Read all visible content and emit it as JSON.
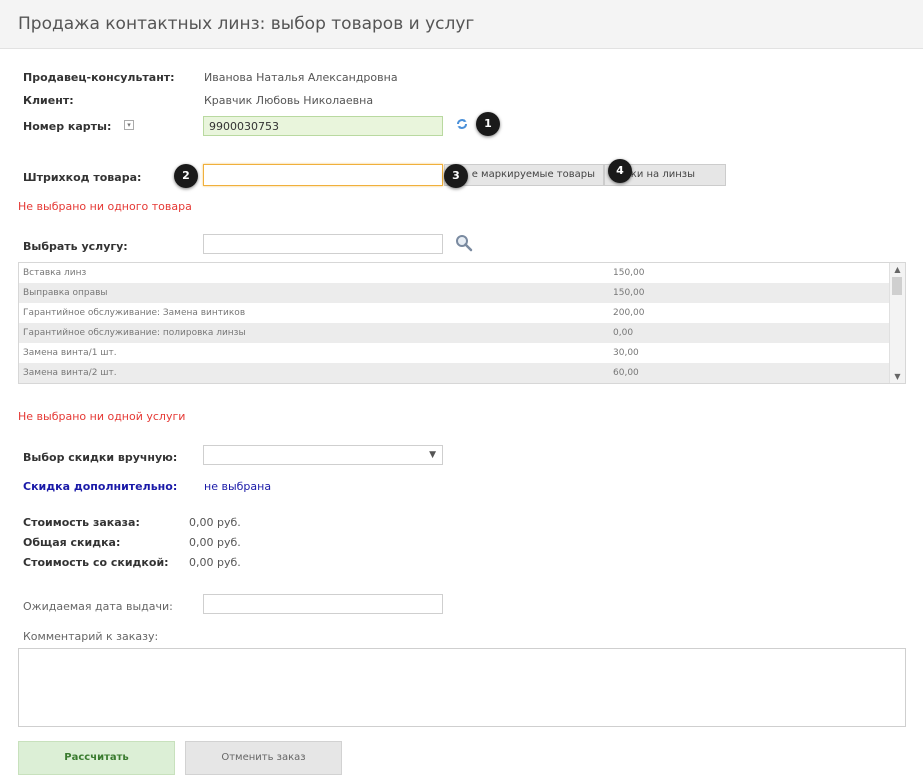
{
  "header": {
    "title": "Продажа контактных линз: выбор товаров и услуг"
  },
  "info": {
    "seller_label": "Продавец-консультант:",
    "seller_value": "Иванова Наталья Александровна",
    "client_label": "Клиент:",
    "client_value": "Кравчик Любовь Николаевна",
    "card_label": "Номер карты:",
    "card_value": "9900030753"
  },
  "barcode": {
    "label": "Штрихкод товара:",
    "value": "",
    "btn_unmarked": "е маркируемые товары",
    "btn_orders": "аявки на линзы"
  },
  "markers": [
    "1",
    "2",
    "3",
    "4"
  ],
  "goods_error": "Не выбрано ни одного товара",
  "service": {
    "label": "Выбрать услугу:",
    "search_value": "",
    "rows": [
      {
        "name": "Вставка линз",
        "price": "150,00"
      },
      {
        "name": "Выправка оправы",
        "price": "150,00"
      },
      {
        "name": "Гарантийное обслуживание: Замена винтиков",
        "price": "200,00"
      },
      {
        "name": "Гарантийное обслуживание: полировка линзы",
        "price": "0,00"
      },
      {
        "name": "Замена винта/1 шт.",
        "price": "30,00"
      },
      {
        "name": "Замена винта/2 шт.",
        "price": "60,00"
      }
    ],
    "error": "Не выбрано ни одной услуги"
  },
  "discount": {
    "manual_label": "Выбор скидки вручную:",
    "manual_value": "",
    "extra_label": "Скидка дополнительно:",
    "extra_value": "не выбрана"
  },
  "totals": {
    "cost_label": "Стоимость заказа:",
    "cost_value": "0,00 руб.",
    "discount_label": "Общая скидка:",
    "discount_value": "0,00 руб.",
    "final_label": "Стоимость со скидкой:",
    "final_value": "0,00 руб."
  },
  "delivery": {
    "label": "Ожидаемая дата выдачи:",
    "value": ""
  },
  "comment": {
    "label": "Комментарий к заказу:",
    "value": ""
  },
  "actions": {
    "calculate": "Рассчитать",
    "cancel": "Отменить заказ"
  },
  "colors": {
    "error": "#e53935",
    "link_blue": "#1a1aa8",
    "green_field": "#e9f5dc",
    "focus_border": "#f0b03c"
  }
}
